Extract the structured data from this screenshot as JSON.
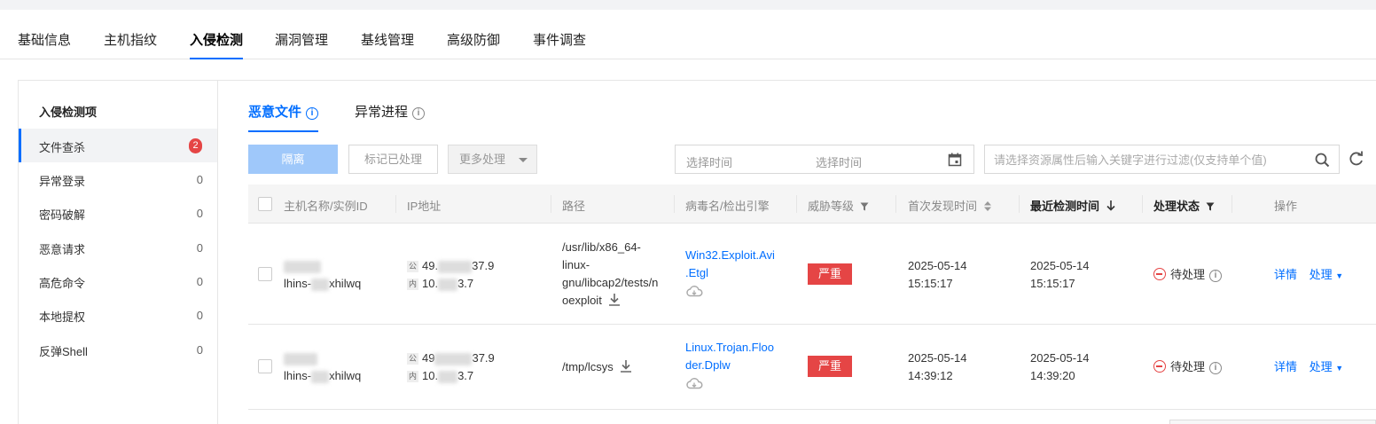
{
  "top_tabs": [
    "基础信息",
    "主机指纹",
    "入侵检测",
    "漏洞管理",
    "基线管理",
    "高级防御",
    "事件调查"
  ],
  "sidebar": {
    "title": "入侵检测项",
    "items": [
      {
        "label": "文件查杀",
        "count": "2"
      },
      {
        "label": "异常登录",
        "count": "0"
      },
      {
        "label": "密码破解",
        "count": "0"
      },
      {
        "label": "恶意请求",
        "count": "0"
      },
      {
        "label": "高危命令",
        "count": "0"
      },
      {
        "label": "本地提权",
        "count": "0"
      },
      {
        "label": "反弹Shell",
        "count": "0"
      }
    ]
  },
  "sub_tabs": [
    "恶意文件",
    "异常进程"
  ],
  "toolbar": {
    "isolate": "隔离",
    "mark_processed": "标记已处理",
    "more_actions": "更多处理",
    "start_time": "选择时间",
    "end_time": "选择时间",
    "search_placeholder": "请选择资源属性后输入关键字进行过滤(仅支持单个值)"
  },
  "columns": [
    "主机名称/实例ID",
    "IP地址",
    "路径",
    "病毒名/检出引擎",
    "威胁等级",
    "首次发现时间",
    "最近检测时间",
    "处理状态",
    "操作"
  ],
  "rows": [
    {
      "host_suffix": "xhilwq",
      "host_prefix": "lhins-",
      "ip_public_a": "49.",
      "ip_public_b": "37.9",
      "ip_private_a": "10.",
      "ip_private_b": "3.7",
      "ip_public_tag": "公",
      "ip_private_tag": "内",
      "path_lines": [
        "/usr/lib/x86_64-",
        "linux-",
        "gnu/libcap2/tests/n",
        "oexploit"
      ],
      "virus_lines": [
        "Win32.Exploit.Avi",
        ".Etgl"
      ],
      "level": "严重",
      "first_date": "2025-05-14",
      "first_time": "15:15:17",
      "last_date": "2025-05-14",
      "last_time": "15:15:17",
      "status": "待处理",
      "detail": "详情",
      "handle": "处理"
    },
    {
      "host_suffix": "xhilwq",
      "host_prefix": "lhins-",
      "ip_public_a": "49",
      "ip_public_b": "37.9",
      "ip_private_a": "10.",
      "ip_private_b": "3.7",
      "ip_public_tag": "公",
      "ip_private_tag": "内",
      "path_lines": [
        "/tmp/lcsys"
      ],
      "virus_lines": [
        "Linux.Trojan.Floo",
        "der.Dplw"
      ],
      "level": "严重",
      "first_date": "2025-05-14",
      "first_time": "14:39:12",
      "last_date": "2025-05-14",
      "last_time": "14:39:20",
      "status": "待处理",
      "detail": "详情",
      "handle": "处理"
    }
  ],
  "colors": {
    "accent": "#006eff",
    "danger": "#e54545"
  }
}
